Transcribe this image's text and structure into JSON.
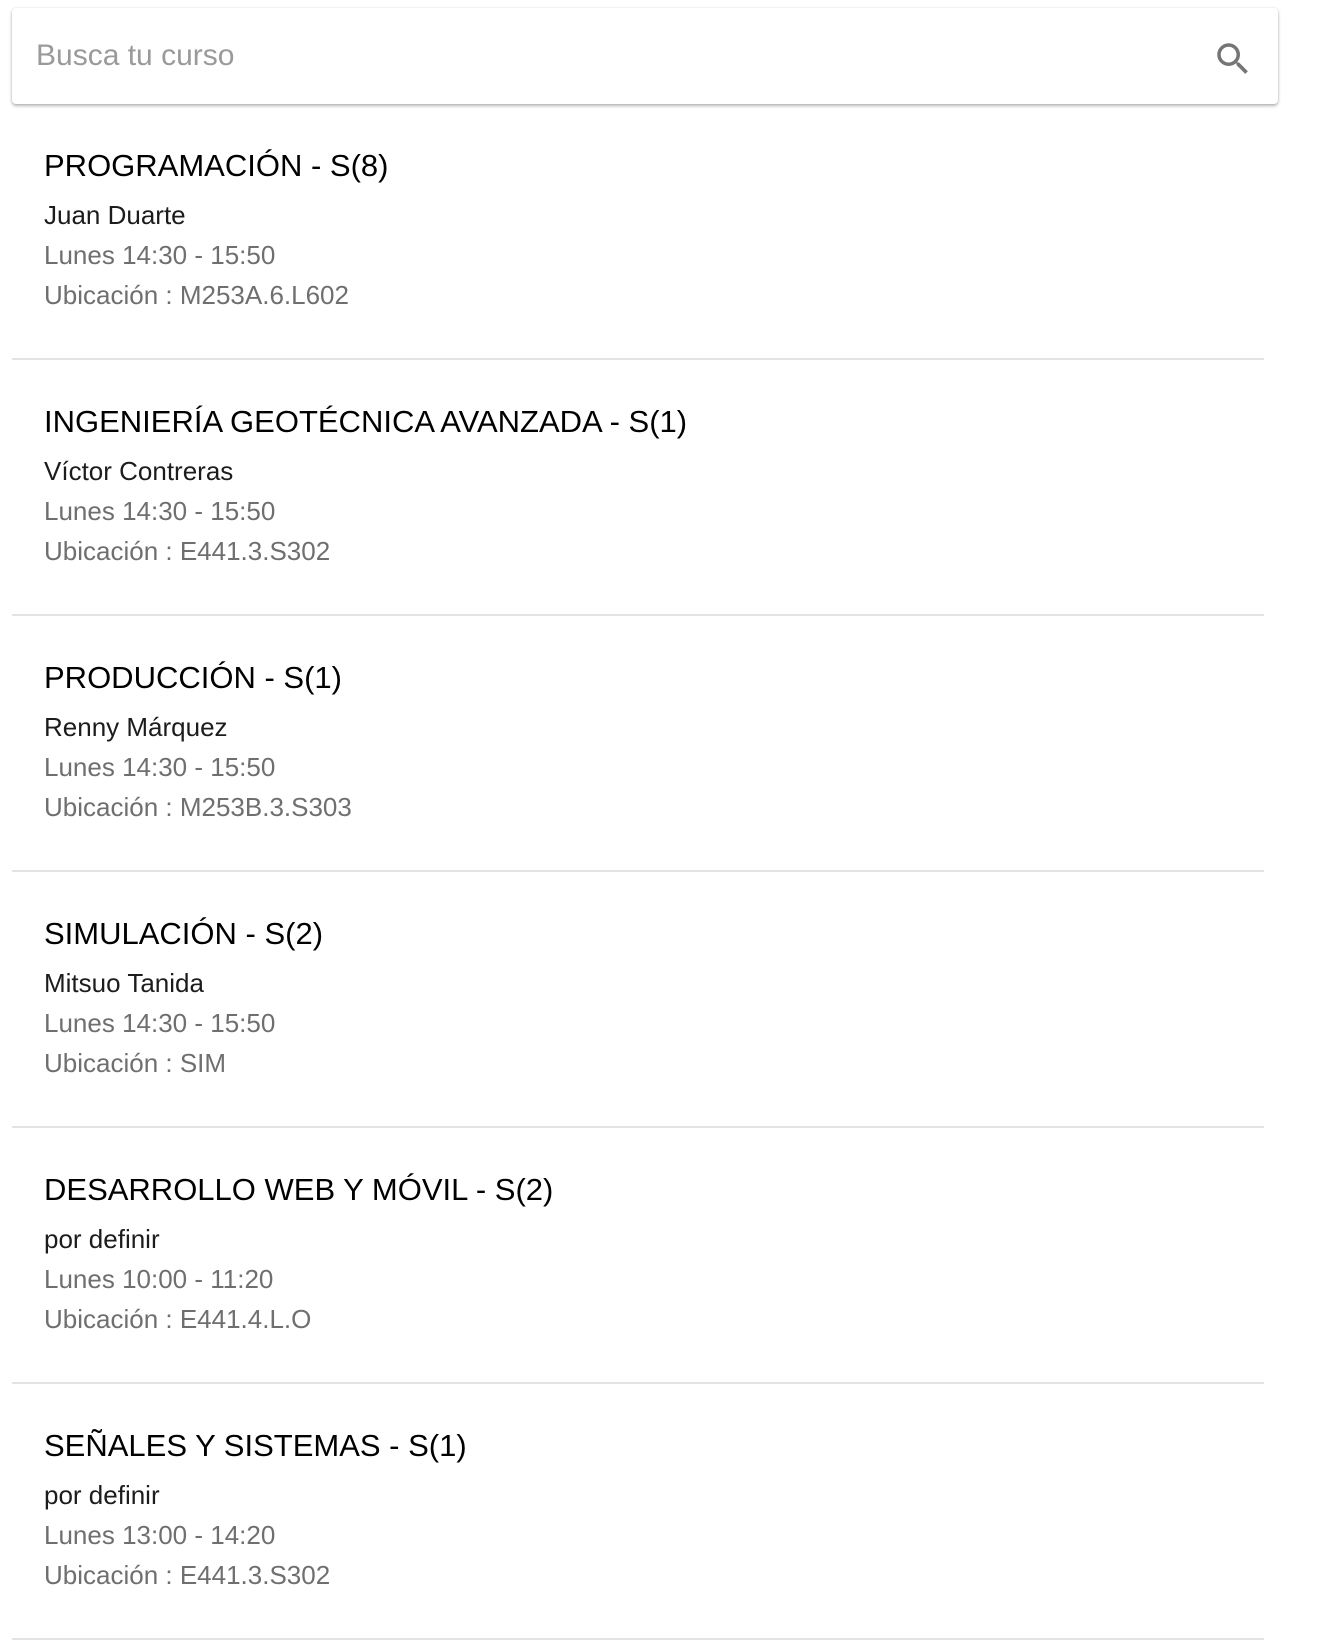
{
  "search": {
    "placeholder": "Busca tu curso",
    "value": "",
    "icon": "search-icon"
  },
  "courses": [
    {
      "title": "PROGRAMACIÓN - S(8)",
      "teacher": "Juan Duarte",
      "schedule": "Lunes 14:30 - 15:50",
      "location": "Ubicación : M253A.6.L602"
    },
    {
      "title": "INGENIERÍA GEOTÉCNICA AVANZADA - S(1)",
      "teacher": "Víctor Contreras",
      "schedule": "Lunes 14:30 - 15:50",
      "location": "Ubicación : E441.3.S302"
    },
    {
      "title": "PRODUCCIÓN - S(1)",
      "teacher": "Renny Márquez",
      "schedule": "Lunes 14:30 - 15:50",
      "location": "Ubicación : M253B.3.S303"
    },
    {
      "title": "SIMULACIÓN - S(2)",
      "teacher": "Mitsuo Tanida",
      "schedule": "Lunes 14:30 - 15:50",
      "location": "Ubicación : SIM"
    },
    {
      "title": "DESARROLLO WEB Y MÓVIL - S(2)",
      "teacher": "por definir",
      "schedule": "Lunes 10:00 - 11:20",
      "location": "Ubicación : E441.4.L.O"
    },
    {
      "title": "SEÑALES Y SISTEMAS - S(1)",
      "teacher": "por definir",
      "schedule": "Lunes 13:00 - 14:20",
      "location": "Ubicación : E441.3.S302"
    }
  ]
}
